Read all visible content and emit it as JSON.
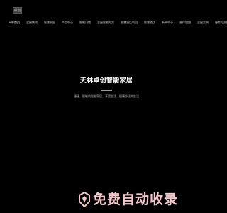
{
  "header": {
    "logo_text": "桌创",
    "nav": [
      {
        "label": "天林首页",
        "active": true
      },
      {
        "label": "全屋集成"
      },
      {
        "label": "智慧家庭"
      },
      {
        "label": "产品中心"
      },
      {
        "label": "智能门锁"
      },
      {
        "label": "全屋智能方案"
      },
      {
        "label": "智慧酒店项目"
      },
      {
        "label": "智慧酒店"
      },
      {
        "label": "新闻中心"
      },
      {
        "label": "合作加盟"
      },
      {
        "label": "全屋案例"
      },
      {
        "label": "服务与支持"
      }
    ]
  },
  "hero": {
    "title": "天林卓创智能家居",
    "subtitle": "便捷、智能的智能家居，享受生活，健康舒适的生活"
  },
  "watermark": {
    "text": "免费自动收录",
    "color": "#f4c9cd"
  }
}
